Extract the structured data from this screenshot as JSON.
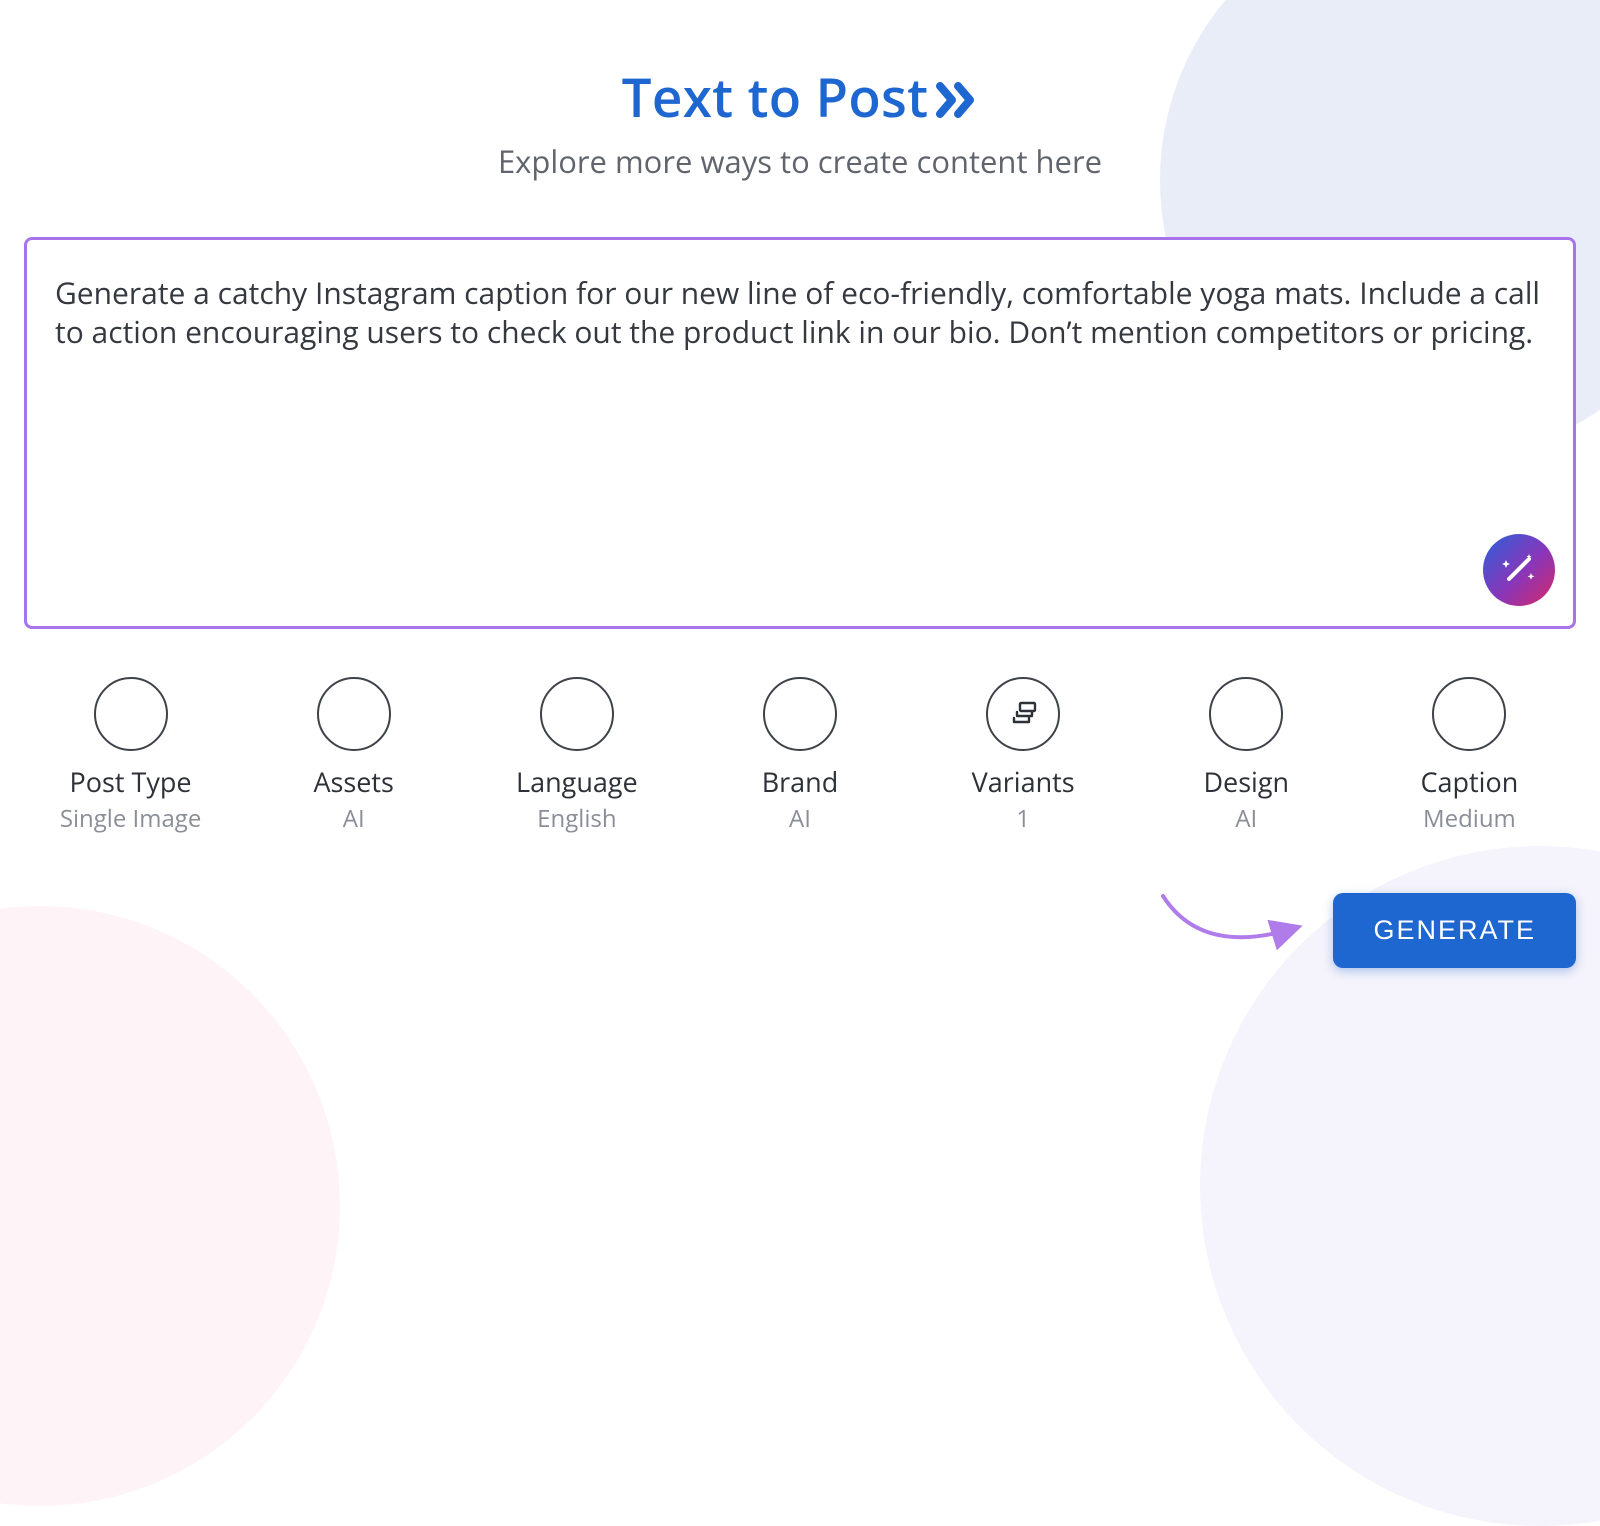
{
  "header": {
    "title": "Text to Post",
    "subtitle": "Explore more ways to create content here"
  },
  "prompt": {
    "value": "Generate a catchy Instagram caption for our new line of eco-friendly, comfortable yoga mats. Include a call to action encouraging users to check out the product link in our bio. Don’t mention competitors or pricing."
  },
  "options": [
    {
      "key": "post-type",
      "label": "Post Type",
      "value": "Single Image",
      "icon": "none"
    },
    {
      "key": "assets",
      "label": "Assets",
      "value": "AI",
      "icon": "none"
    },
    {
      "key": "language",
      "label": "Language",
      "value": "English",
      "icon": "none"
    },
    {
      "key": "brand",
      "label": "Brand",
      "value": "AI",
      "icon": "none"
    },
    {
      "key": "variants",
      "label": "Variants",
      "value": "1",
      "icon": "layers"
    },
    {
      "key": "design",
      "label": "Design",
      "value": "AI",
      "icon": "none"
    },
    {
      "key": "caption",
      "label": "Caption",
      "value": "Medium",
      "icon": "none"
    }
  ],
  "actions": {
    "generate_label": "GENERATE"
  },
  "colors": {
    "accent_blue": "#1e66d0",
    "box_border": "#a874ea",
    "arrow": "#b07ce9"
  }
}
